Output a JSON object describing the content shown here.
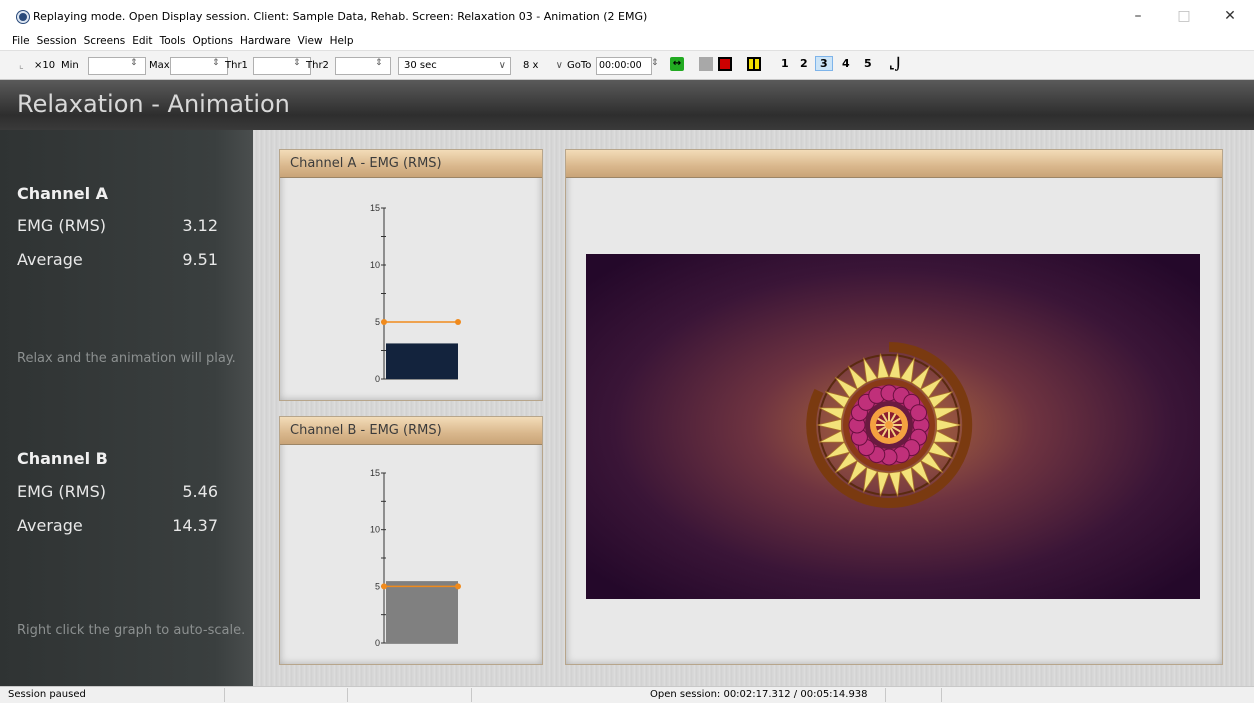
{
  "window": {
    "title": "Replaying mode. Open Display session. Client: Sample Data, Rehab. Screen: Relaxation 03 - Animation (2 EMG)",
    "minimize": "–",
    "maximize": "□",
    "close": "✕"
  },
  "menu": [
    "File",
    "Session",
    "Screens",
    "Edit",
    "Tools",
    "Options",
    "Hardware",
    "View",
    "Help"
  ],
  "toolbar": {
    "scale_label": "×10",
    "min_label": "Min",
    "max_label": "Max",
    "thr1_label": "Thr1",
    "thr2_label": "Thr2",
    "timebase": "30 sec",
    "speed": "8 x",
    "goto_label": "GoTo",
    "goto_value": "00:00:00",
    "screen_numbers": [
      "1",
      "2",
      "3",
      "4",
      "5"
    ],
    "active_screen": "3",
    "colors": {
      "swap_icon": "#22aa22",
      "stop_fill": "#cc0000",
      "pause_fill": "#f2e000"
    }
  },
  "header": {
    "title": "Relaxation - Animation"
  },
  "left_panel": {
    "channel_a": {
      "heading": "Channel A",
      "emg_label": "EMG (RMS)",
      "emg_value": "3.12",
      "avg_label": "Average",
      "avg_value": "9.51"
    },
    "note_a": "Relax and the animation will play.",
    "channel_b": {
      "heading": "Channel B",
      "emg_label": "EMG (RMS)",
      "emg_value": "5.46",
      "avg_label": "Average",
      "avg_value": "14.37"
    },
    "note_b": "Right click the graph to auto-scale."
  },
  "graph_a": {
    "title": "Channel A - EMG (RMS)",
    "ylim": [
      0,
      15
    ],
    "ticks": [
      "0",
      "5",
      "10",
      "15"
    ],
    "bar_value": 3.12,
    "threshold": 5,
    "bar_color": "#13233d",
    "threshold_color": "#f08a1c"
  },
  "graph_b": {
    "title": "Channel B - EMG (RMS)",
    "ylim": [
      0,
      15
    ],
    "ticks": [
      "0",
      "5",
      "10",
      "15"
    ],
    "bar_value": 5.46,
    "threshold": 5,
    "bar_color": "#808080",
    "threshold_color": "#f08a1c"
  },
  "animation": {
    "title": ""
  },
  "status": {
    "left": "Session paused",
    "session": "Open session: 00:02:17.312 / 00:05:14.938"
  }
}
